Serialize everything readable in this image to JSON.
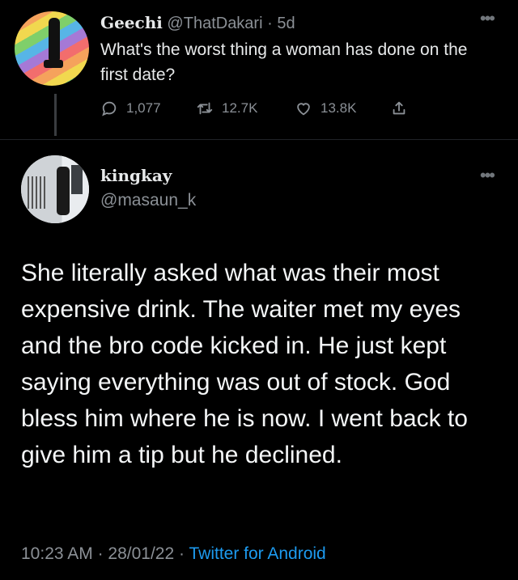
{
  "original_tweet": {
    "display_name": "Geechi",
    "handle": "@ThatDakari",
    "separator": "·",
    "age": "5d",
    "text": "What's the worst thing a woman has done on the first date?",
    "more_icon": "ellipsis-icon",
    "stats": {
      "replies": "1,077",
      "retweets": "12.7K",
      "likes": "13.8K"
    }
  },
  "reply_tweet": {
    "display_name": "kingkay",
    "handle": "@masaun_k",
    "more_icon": "ellipsis-icon",
    "text": "She literally asked what was their most expensive drink. The waiter met my eyes and the bro code kicked in. He just kept saying everything was out of stock. God bless him where he is now. I went back to give him a tip but he declined.",
    "time": "10:23 AM",
    "separator": "·",
    "date": "28/01/22",
    "source": "Twitter for Android"
  },
  "colors": {
    "background": "#000000",
    "text": "#e7e9ea",
    "muted": "#8b9096",
    "link": "#1d9bf0"
  }
}
